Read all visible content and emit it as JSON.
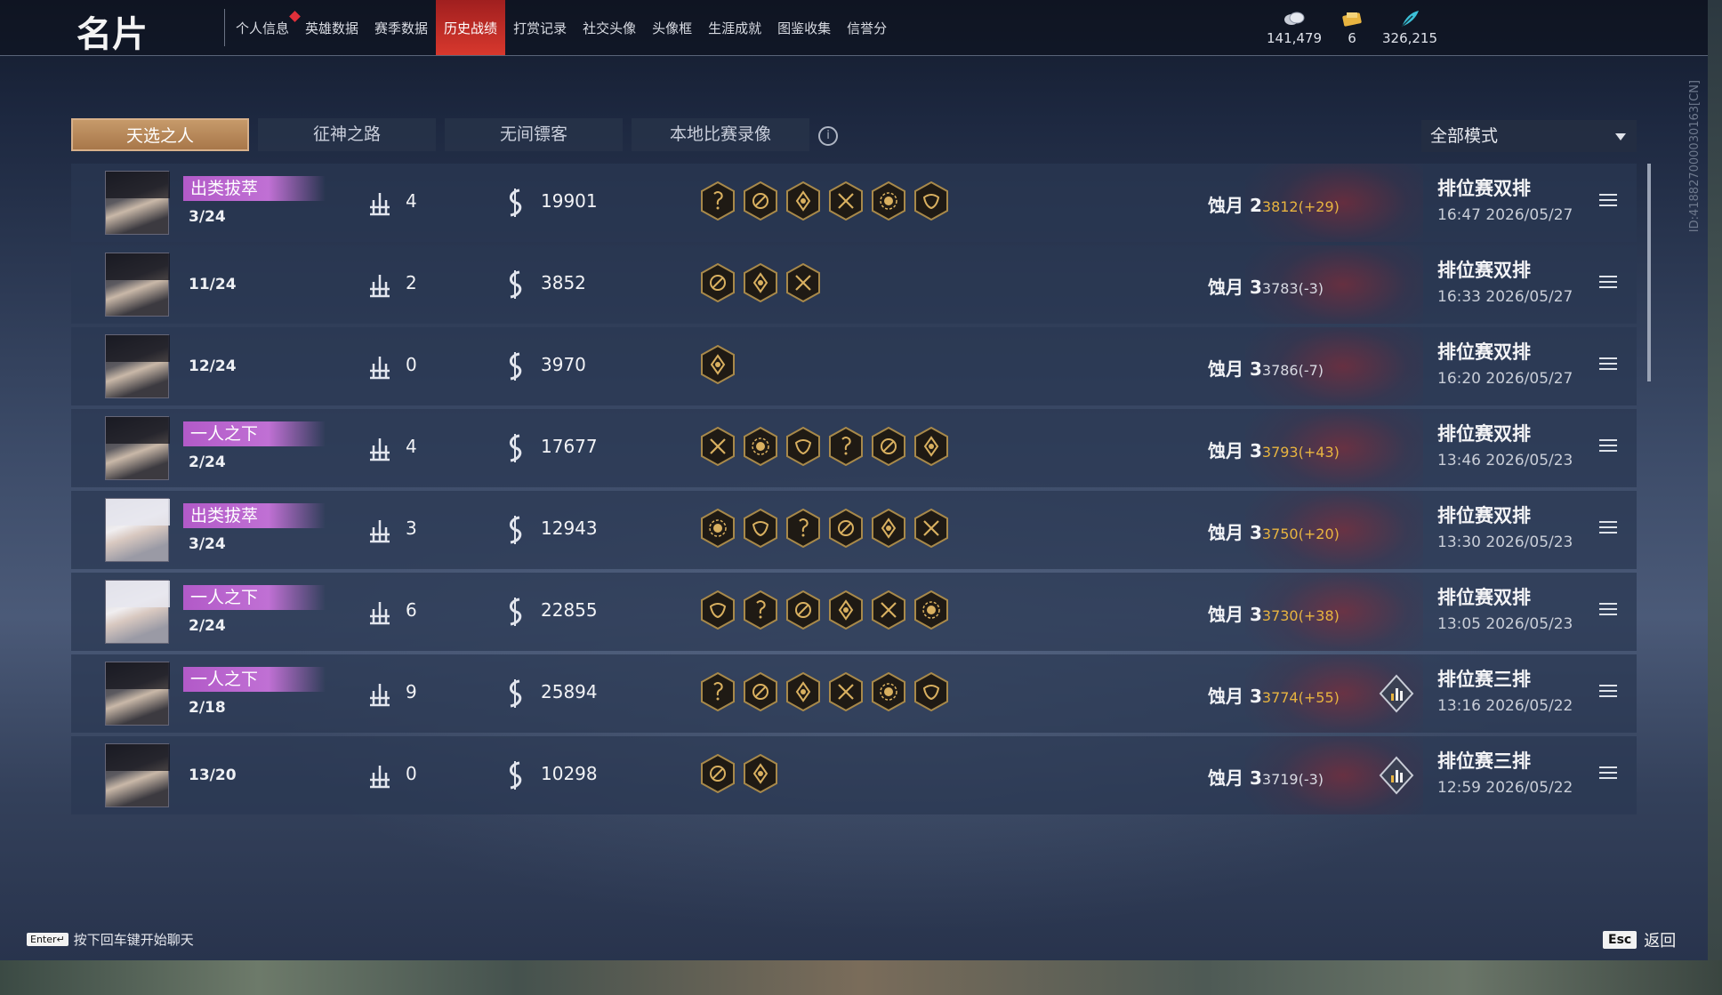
{
  "header": {
    "title": "名片",
    "nav": [
      {
        "label": "个人信息"
      },
      {
        "label": "英雄数据"
      },
      {
        "label": "赛季数据"
      },
      {
        "label": "历史战绩"
      },
      {
        "label": "打赏记录"
      },
      {
        "label": "社交头像"
      },
      {
        "label": "头像框"
      },
      {
        "label": "生涯成就"
      },
      {
        "label": "图鉴收集"
      },
      {
        "label": "信誉分"
      }
    ],
    "active_nav": "历史战绩",
    "currencies": [
      {
        "icon": "coins-icon",
        "value": "141,479"
      },
      {
        "icon": "ticket-icon",
        "value": "6"
      },
      {
        "icon": "feather-icon",
        "value": "326,215"
      }
    ]
  },
  "tabs": [
    "天选之人",
    "征神之路",
    "无间镖客",
    "本地比赛录像"
  ],
  "active_tab": "天选之人",
  "mode_select": {
    "value": "全部模式"
  },
  "side_id": "ID:4188270000301​63[CN]",
  "matches": [
    {
      "badge": "出类拔萃",
      "rank": "3/24",
      "kills": "4",
      "damage": "19901",
      "items": 6,
      "tier": "蚀月 2",
      "score": "3812(+29)",
      "score_type": "pos",
      "mode": "排位赛双排",
      "time": "16:47  2026/05/27",
      "stat": false,
      "avatar": "dark"
    },
    {
      "badge": "",
      "rank": "11/24",
      "kills": "2",
      "damage": "3852",
      "items": 3,
      "tier": "蚀月 3",
      "score": "3783(-3)",
      "score_type": "neg",
      "mode": "排位赛双排",
      "time": "16:33  2026/05/27",
      "stat": false,
      "avatar": "dark"
    },
    {
      "badge": "",
      "rank": "12/24",
      "kills": "0",
      "damage": "3970",
      "items": 1,
      "tier": "蚀月 3",
      "score": "3786(-7)",
      "score_type": "neg",
      "mode": "排位赛双排",
      "time": "16:20  2026/05/27",
      "stat": false,
      "avatar": "dark"
    },
    {
      "badge": "一人之下",
      "rank": "2/24",
      "kills": "4",
      "damage": "17677",
      "items": 6,
      "tier": "蚀月 3",
      "score": "3793(+43)",
      "score_type": "pos",
      "mode": "排位赛双排",
      "time": "13:46  2026/05/23",
      "stat": false,
      "avatar": "dark"
    },
    {
      "badge": "出类拔萃",
      "rank": "3/24",
      "kills": "3",
      "damage": "12943",
      "items": 6,
      "tier": "蚀月 3",
      "score": "3750(+20)",
      "score_type": "pos",
      "mode": "排位赛双排",
      "time": "13:30  2026/05/23",
      "stat": false,
      "avatar": "light"
    },
    {
      "badge": "一人之下",
      "rank": "2/24",
      "kills": "6",
      "damage": "22855",
      "items": 6,
      "tier": "蚀月 3",
      "score": "3730(+38)",
      "score_type": "pos",
      "mode": "排位赛双排",
      "time": "13:05  2026/05/23",
      "stat": false,
      "avatar": "light"
    },
    {
      "badge": "一人之下",
      "rank": "2/18",
      "kills": "9",
      "damage": "25894",
      "items": 6,
      "tier": "蚀月 3",
      "score": "3774(+55)",
      "score_type": "pos",
      "mode": "排位赛三排",
      "time": "13:16  2026/05/22",
      "stat": true,
      "avatar": "dark"
    },
    {
      "badge": "",
      "rank": "13/20",
      "kills": "0",
      "damage": "10298",
      "items": 2,
      "tier": "蚀月 3",
      "score": "3719(-3)",
      "score_type": "neg",
      "mode": "排位赛三排",
      "time": "12:59  2026/05/22",
      "stat": true,
      "avatar": "dark"
    }
  ],
  "footer": {
    "enter_key": "Enter↵",
    "enter_hint": "按下回车键开始聊天",
    "esc_key": "Esc",
    "esc_label": "返回"
  },
  "colors": {
    "active_nav": "#d8382d",
    "active_tab": "#b8865a",
    "badge": "#c070d4",
    "score_pos": "#e8b440"
  }
}
